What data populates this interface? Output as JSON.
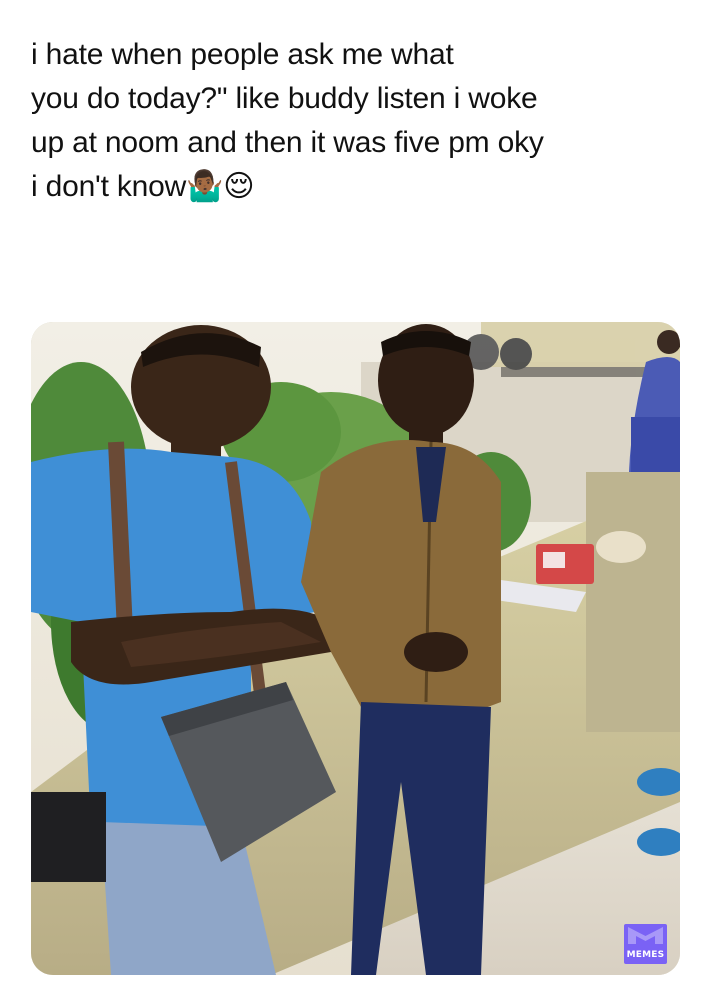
{
  "post": {
    "caption": " i hate when people ask me what\nyou do today?\" like buddy listen i woke\nup at noom and then it was five pm oky\ni don't know🤷🏾‍♂️😌"
  },
  "watermark": {
    "label": "MEMES",
    "color": "#7a62f5"
  },
  "photo": {
    "subject": "two young men leaning on a low concrete wall",
    "left_person_shirt_color": "#3f8fd6",
    "right_person_jacket_color": "#8a6a3a",
    "icons": [
      "shoulder-bag-icon"
    ]
  }
}
